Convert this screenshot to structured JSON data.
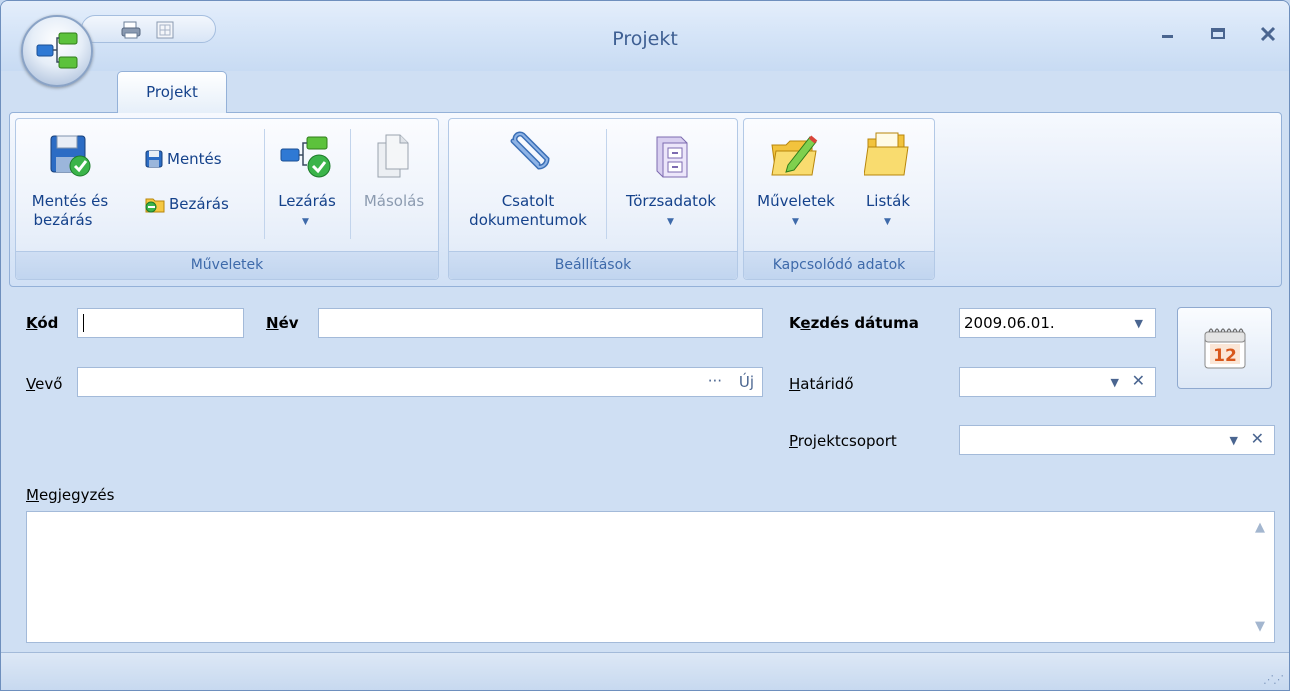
{
  "window": {
    "title": "Projekt"
  },
  "tabs": [
    {
      "label": "Projekt",
      "active": true
    }
  ],
  "ribbon": {
    "groups": [
      {
        "label": "Műveletek",
        "buttons": [
          {
            "label": "Mentés és bezárás",
            "line1": "Mentés és",
            "line2": "bezárás",
            "icon": "save-close-icon"
          },
          {
            "label": "Mentés",
            "icon": "save-icon"
          },
          {
            "label": "Bezárás",
            "icon": "close-folder-icon"
          },
          {
            "label": "Lezárás",
            "icon": "finalize-icon",
            "dropdown": true
          },
          {
            "label": "Másolás",
            "icon": "copy-icon",
            "disabled": true
          }
        ]
      },
      {
        "label": "Beállítások",
        "buttons": [
          {
            "label": "Csatolt dokumentumok",
            "line1": "Csatolt",
            "line2": "dokumentumok",
            "icon": "paperclip-icon"
          },
          {
            "label": "Törzsadatok",
            "icon": "cabinet-icon",
            "dropdown": true
          }
        ]
      },
      {
        "label": "Kapcsolódó adatok",
        "buttons": [
          {
            "label": "Műveletek",
            "icon": "folder-edit-icon",
            "dropdown": true
          },
          {
            "label": "Listák",
            "icon": "folder-list-icon",
            "dropdown": true
          }
        ]
      }
    ]
  },
  "form": {
    "kod": {
      "label": "Kód",
      "value": ""
    },
    "nev": {
      "label": "Név",
      "value": ""
    },
    "vevo": {
      "label": "Vevő",
      "value": "",
      "browse": "···",
      "new": "Új"
    },
    "kezdes": {
      "label": "Kezdés dátuma",
      "value": "2009.06.01."
    },
    "hatarido": {
      "label": "Határidő",
      "value": ""
    },
    "projektcsoport": {
      "label": "Projektcsoport",
      "value": ""
    },
    "calendar": {
      "day": "12",
      "icon": "calendar-icon"
    },
    "megjegyzes": {
      "label": "Megjegyzés",
      "value": ""
    }
  },
  "colors": {
    "accent": "#15428b",
    "ribbon_label": "#3e6aaa",
    "frame": "#cfdff3"
  }
}
